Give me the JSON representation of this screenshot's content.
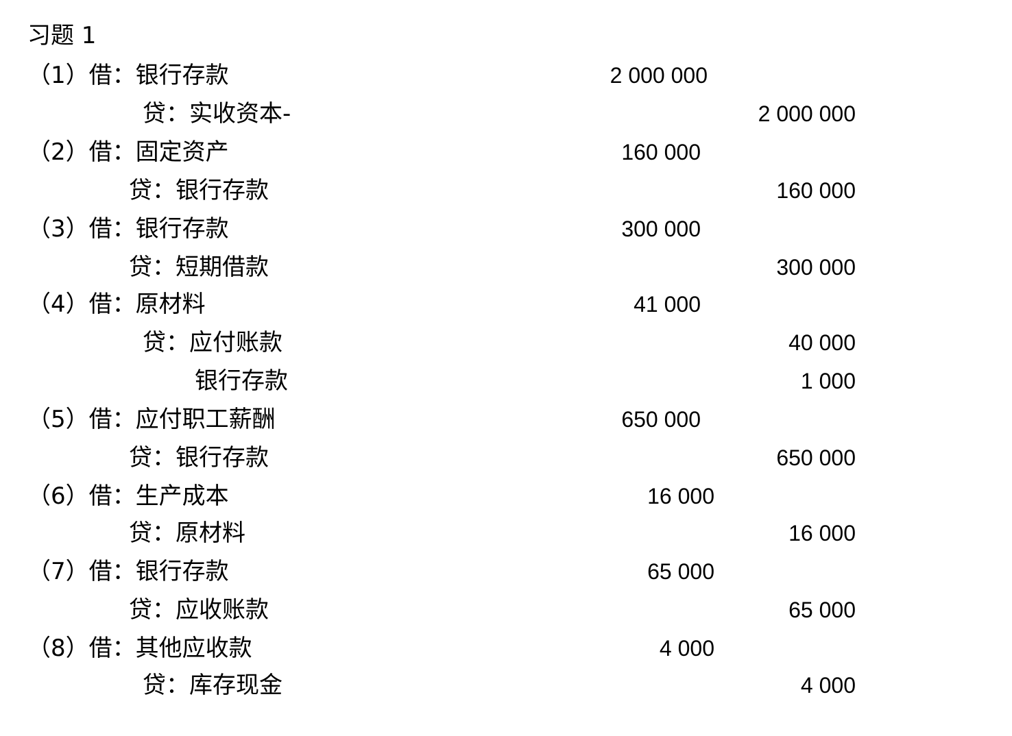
{
  "title": "习题 1",
  "entries": [
    {
      "label": "（1）借：银行存款",
      "debit": "2 000 000",
      "credit": ""
    },
    {
      "label": "贷：实收资本-",
      "debit": "",
      "credit": "2 000 000"
    },
    {
      "label": "（2）借：固定资产",
      "debit": "160 000",
      "credit": ""
    },
    {
      "label": "贷：银行存款",
      "debit": "",
      "credit": "160 000"
    },
    {
      "label": "（3）借：银行存款",
      "debit": "300 000",
      "credit": ""
    },
    {
      "label": "贷：短期借款",
      "debit": "",
      "credit": "300 000"
    },
    {
      "label": "（4）借：原材料",
      "debit": "41 000",
      "credit": ""
    },
    {
      "label": "贷：应付账款",
      "debit": "",
      "credit": "40 000"
    },
    {
      "label": "银行存款",
      "debit": "",
      "credit": "1 000"
    },
    {
      "label": "（5）借：应付职工薪酬",
      "debit": "650 000",
      "credit": ""
    },
    {
      "label": "贷：银行存款",
      "debit": "",
      "credit": "650 000"
    },
    {
      "label": "（6）借：生产成本",
      "debit": "16 000",
      "credit": ""
    },
    {
      "label": "贷：原材料",
      "debit": "",
      "credit": "16 000"
    },
    {
      "label": "（7）借：银行存款",
      "debit": "65 000",
      "credit": ""
    },
    {
      "label": "贷：应收账款",
      "debit": "",
      "credit": "65 000"
    },
    {
      "label": "（8）借：其他应收款",
      "debit": "4 000",
      "credit": ""
    },
    {
      "label": "贷：库存现金",
      "debit": "",
      "credit": "4 000"
    }
  ]
}
